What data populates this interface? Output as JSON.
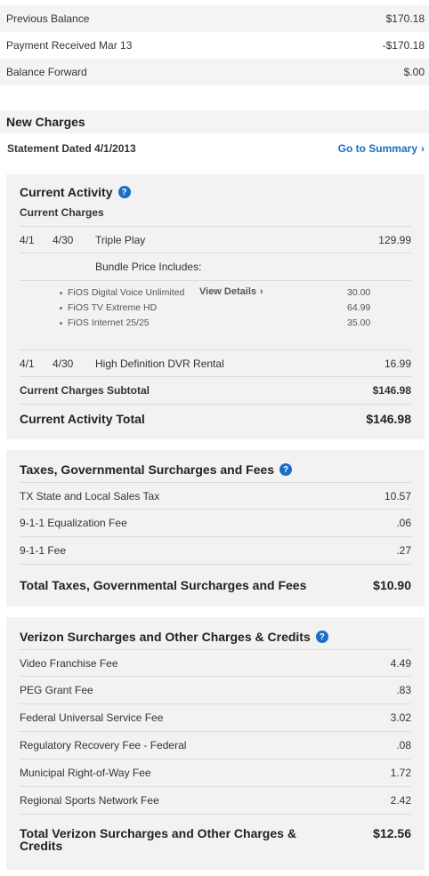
{
  "balance": {
    "previous_label": "Previous Balance",
    "previous_value": "$170.18",
    "payment_label": "Payment Received Mar 13",
    "payment_value": "-$170.18",
    "forward_label": "Balance Forward",
    "forward_value": "$.00"
  },
  "new_charges": {
    "title": "New Charges",
    "statement_label": "Statement Dated 4/1/2013",
    "summary_link": "Go to Summary",
    "chevron": "›"
  },
  "current_activity": {
    "title": "Current Activity",
    "help": "?",
    "subheader": "Current Charges",
    "triple_play": {
      "from": "4/1",
      "to": "4/30",
      "desc": "Triple Play",
      "amount": "129.99"
    },
    "bundle_header": "Bundle Price Includes:",
    "bundle_items": [
      {
        "name": "FiOS Digital Voice Unlimited",
        "amount": "30.00",
        "link": "View Details"
      },
      {
        "name": "FiOS TV Extreme HD",
        "amount": "64.99"
      },
      {
        "name": "FiOS Internet 25/25",
        "amount": "35.00"
      }
    ],
    "dvr": {
      "from": "4/1",
      "to": "4/30",
      "desc": "High Definition DVR Rental",
      "amount": "16.99"
    },
    "subtotal_label": "Current Charges Subtotal",
    "subtotal_value": "$146.98",
    "total_label": "Current Activity Total",
    "total_value": "$146.98"
  },
  "taxes": {
    "title": "Taxes, Governmental Surcharges and Fees",
    "help": "?",
    "items": [
      {
        "label": "TX State and Local Sales Tax",
        "value": "10.57"
      },
      {
        "label": "9-1-1 Equalization Fee",
        "value": ".06"
      },
      {
        "label": "9-1-1 Fee",
        "value": ".27"
      }
    ],
    "total_label": "Total Taxes, Governmental Surcharges and Fees",
    "total_value": "$10.90"
  },
  "verizon": {
    "title": "Verizon Surcharges and Other Charges & Credits",
    "help": "?",
    "items": [
      {
        "label": "Video Franchise Fee",
        "value": "4.49"
      },
      {
        "label": "PEG Grant Fee",
        "value": ".83"
      },
      {
        "label": "Federal Universal Service Fee",
        "value": "3.02"
      },
      {
        "label": "Regulatory Recovery Fee - Federal",
        "value": ".08"
      },
      {
        "label": "Municipal Right-of-Way Fee",
        "value": "1.72"
      },
      {
        "label": "Regional Sports Network Fee",
        "value": "2.42"
      }
    ],
    "total_label_line1": "Total Verizon Surcharges and Other Charges &",
    "total_label_line2": "Credits",
    "total_value": "$12.56"
  }
}
